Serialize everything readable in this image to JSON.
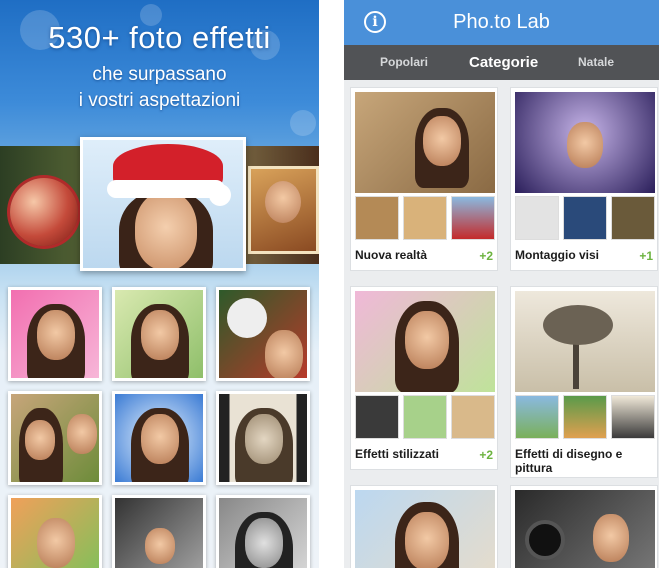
{
  "promo": {
    "headline": "530+ foto effetti",
    "subline1": "che surpassano",
    "subline2": "i vostri aspettazioni"
  },
  "app": {
    "title": "Pho.to Lab",
    "info_icon": "info-icon",
    "info_glyph": "i"
  },
  "tabs": [
    {
      "label": "Popolari",
      "active": false
    },
    {
      "label": "Categorie",
      "active": true
    },
    {
      "label": "Natale",
      "active": false
    }
  ],
  "categories": [
    {
      "label": "Nuova realtà",
      "count": "+2"
    },
    {
      "label": "Montaggio visi",
      "count": "+1"
    },
    {
      "label": "Effetti stilizzati",
      "count": "+2"
    },
    {
      "label": "Effetti di disegno e pittura",
      "count": ""
    },
    {
      "label": "",
      "count": ""
    },
    {
      "label": "",
      "count": ""
    }
  ],
  "colors": {
    "topbar": "#4a90d9",
    "tabbar": "#515356",
    "count_green": "#6cb33f"
  }
}
